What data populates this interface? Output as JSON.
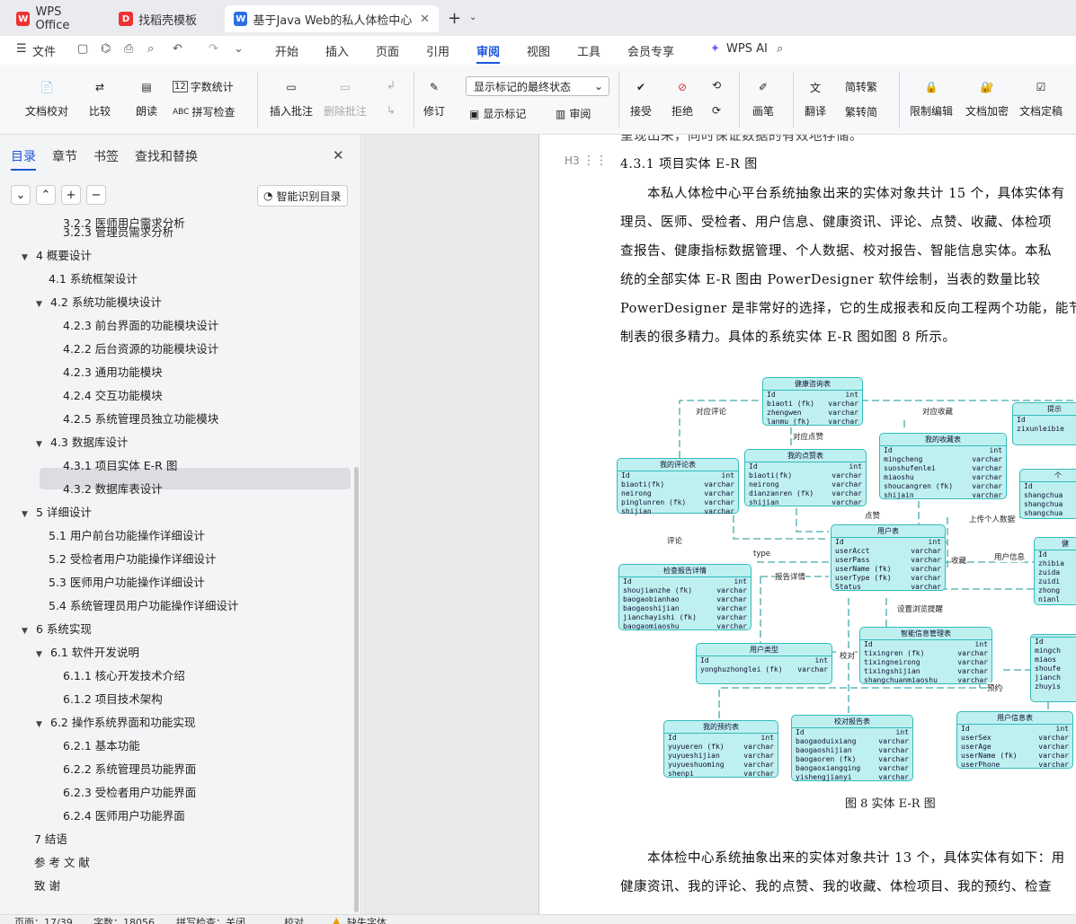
{
  "tabs": [
    {
      "label": "WPS Office",
      "icon": "wps-icon"
    },
    {
      "label": "找稻壳模板",
      "icon": "docer-icon"
    },
    {
      "label": "基于Java Web的私人体检中心",
      "icon": "word-icon"
    }
  ],
  "menu": {
    "file": "文件",
    "items": [
      "开始",
      "插入",
      "页面",
      "引用",
      "审阅",
      "视图",
      "工具",
      "会员专享"
    ],
    "active": "审阅",
    "ai": "WPS AI"
  },
  "ribbon": {
    "doc_check": "文档校对",
    "compare": "比较",
    "read": "朗读",
    "word_count": "字数统计",
    "spell_check": "拼写检查",
    "insert_comment": "插入批注",
    "delete_comment": "删除批注",
    "revise": "修订",
    "markup_state": "显示标记的最终状态",
    "show_markup": "显示标记",
    "review": "审阅",
    "accept": "接受",
    "reject": "拒绝",
    "pen": "画笔",
    "translate": "翻译",
    "to_traditional": "简转繁",
    "to_simplified": "繁转简",
    "restrict_edit": "限制编辑",
    "encrypt": "文档加密",
    "finalize": "文档定稿"
  },
  "panel": {
    "tabs": [
      "目录",
      "章节",
      "书签",
      "查找和替换"
    ],
    "smart_toc": "智能识别目录",
    "toc": [
      {
        "text": "3.2.2  医师用户需求分析",
        "level": 3
      },
      {
        "text": "3.2.3  管理员需求分析",
        "level": 3
      },
      {
        "text": "4  概要设计",
        "level": 1,
        "open": true
      },
      {
        "text": "4.1  系统框架设计",
        "level": 2
      },
      {
        "text": "4.2  系统功能模块设计",
        "level": 2,
        "open": true
      },
      {
        "text": "4.2.3  前台界面的功能模块设计",
        "level": 3
      },
      {
        "text": "4.2.2  后台资源的功能模块设计",
        "level": 3
      },
      {
        "text": "4.2.3  通用功能模块",
        "level": 3
      },
      {
        "text": "4.2.4  交互功能模块",
        "level": 3
      },
      {
        "text": "4.2.5  系统管理员独立功能模块",
        "level": 3
      },
      {
        "text": "4.3  数据库设计",
        "level": 2,
        "open": true
      },
      {
        "text": "4.3.1  项目实体 E-R 图",
        "level": 3,
        "selected": true
      },
      {
        "text": "4.3.2  数据库表设计",
        "level": 3
      },
      {
        "text": "5  详细设计",
        "level": 1,
        "open": true
      },
      {
        "text": "5.1 用户前台功能操作详细设计",
        "level": 2
      },
      {
        "text": "5.2 受检者用户功能操作详细设计",
        "level": 2
      },
      {
        "text": "5.3  医师用户功能操作详细设计",
        "level": 2
      },
      {
        "text": "5.4  系统管理员用户功能操作详细设计",
        "level": 2
      },
      {
        "text": "6  系统实现",
        "level": 1,
        "open": true
      },
      {
        "text": "6.1  软件开发说明",
        "level": 2,
        "open": true
      },
      {
        "text": "6.1.1  核心开发技术介绍",
        "level": 3
      },
      {
        "text": "6.1.2  项目技术架构",
        "level": 3
      },
      {
        "text": "6.2  操作系统界面和功能实现",
        "level": 2,
        "open": true
      },
      {
        "text": "6.2.1  基本功能",
        "level": 3
      },
      {
        "text": "6.2.2  系统管理员功能界面",
        "level": 3
      },
      {
        "text": "6.2.3  受检者用户功能界面",
        "level": 3
      },
      {
        "text": "6.2.4  医师用户功能界面",
        "level": 3
      },
      {
        "text": "7  结语",
        "level": 1
      },
      {
        "text": "参 考 文 献",
        "level": 1
      },
      {
        "text": "致    谢",
        "level": 1
      }
    ]
  },
  "doc": {
    "top_fragment": "呈现出来，同时保证数据的有效地存储。",
    "heading_marker": "H3",
    "heading": "4.3.1  项目实体 E-R 图",
    "para1": [
      "本私人体检中心平台系统抽象出来的实体对象共计 15 个，具体实体有",
      "理员、医师、受检者、用户信息、健康资讯、评论、点赞、收藏、体检项",
      "查报告、健康指标数据管理、个人数据、校对报告、智能信息实体。本私",
      "统的全部实体 E-R 图由 PowerDesigner 软件绘制，当表的数量比较",
      "PowerDesigner 是非常好的选择，它的生成报表和反向工程两个功能，能节",
      "制表的很多精力。具体的系统实体 E-R 图如图 8 所示。"
    ],
    "caption": "图 8  实体 E-R 图",
    "para2": [
      "本体检中心系统抽象出来的实体对象共计 13 个，具体实体有如下：用",
      "健康资讯、我的评论、我的点赞、我的收藏、体检项目、我的预约、检查"
    ]
  },
  "er": {
    "entities": [
      {
        "id": "health",
        "title": "健康咨询表",
        "rows": [
          [
            "Id",
            "int"
          ],
          [
            "biaoti (fk)",
            "varchar"
          ],
          [
            "zhengwen",
            "varchar"
          ],
          [
            "lanmu (fk)",
            "varchar"
          ]
        ]
      },
      {
        "id": "comment",
        "title": "我的评论表",
        "rows": [
          [
            "Id",
            "int"
          ],
          [
            "biaoti(fk)",
            "varchar"
          ],
          [
            "neirong",
            "varchar"
          ],
          [
            "pinglunren (fk)",
            "varchar"
          ],
          [
            "shijian",
            "varchar"
          ]
        ]
      },
      {
        "id": "like",
        "title": "我的点赞表",
        "rows": [
          [
            "Id",
            "int"
          ],
          [
            "biaoti(fk)",
            "varchar"
          ],
          [
            "neirong",
            "varchar"
          ],
          [
            "dianzanren (fk)",
            "varchar"
          ],
          [
            "shijian",
            "varchar"
          ]
        ]
      },
      {
        "id": "fav",
        "title": "我的收藏表",
        "rows": [
          [
            "Id",
            "int"
          ],
          [
            "mingcheng",
            "varchar"
          ],
          [
            "suoshufenlei",
            "varchar"
          ],
          [
            "miaoshu",
            "varchar"
          ],
          [
            "shoucangren (fk)",
            "varchar"
          ],
          [
            "shijain",
            "varchar"
          ]
        ]
      },
      {
        "id": "user",
        "title": "用户表",
        "rows": [
          [
            "Id",
            "int"
          ],
          [
            "userAcct",
            "varchar"
          ],
          [
            "userPass",
            "varchar"
          ],
          [
            "userName (fk)",
            "varchar"
          ],
          [
            "userType (fk)",
            "varchar"
          ],
          [
            "Status",
            "varchar"
          ]
        ]
      },
      {
        "id": "report",
        "title": "检查报告详情",
        "rows": [
          [
            "Id",
            "int"
          ],
          [
            "shoujianzhe (fk)",
            "varchar"
          ],
          [
            "baogaobianhao",
            "varchar"
          ],
          [
            "baogaoshijian",
            "varchar"
          ],
          [
            "jianchayishi (fk)",
            "varchar"
          ],
          [
            "baogaomiaoshu",
            "varchar"
          ]
        ]
      },
      {
        "id": "smart",
        "title": "智能信息管理表",
        "rows": [
          [
            "Id",
            "int"
          ],
          [
            "tixingren (fk)",
            "varchar"
          ],
          [
            "tixingneirong",
            "varchar"
          ],
          [
            "tixingshijian",
            "varchar"
          ],
          [
            "shangchuanmiaoshu",
            "varchar"
          ]
        ]
      },
      {
        "id": "utype",
        "title": "用户类型",
        "rows": [
          [
            "Id",
            "int"
          ],
          [
            "yonghuzhonglei (fk)",
            "varchar"
          ]
        ]
      },
      {
        "id": "appt",
        "title": "我的预约表",
        "rows": [
          [
            "Id",
            "int"
          ],
          [
            "yuyueren (fk)",
            "varchar"
          ],
          [
            "yuyueshijian",
            "varchar"
          ],
          [
            "yuyueshuoming",
            "varchar"
          ],
          [
            "shenpi",
            "varchar"
          ]
        ]
      },
      {
        "id": "check",
        "title": "校对报告表",
        "rows": [
          [
            "Id",
            "int"
          ],
          [
            "baogaoduixiang",
            "varchar"
          ],
          [
            "baogaoshijian",
            "varchar"
          ],
          [
            "baogaoren (fk)",
            "varchar"
          ],
          [
            "baogaoxiangqing",
            "varchar"
          ],
          [
            "yishengjianyi",
            "varchar"
          ]
        ]
      },
      {
        "id": "uinfo",
        "title": "用户信息表",
        "rows": [
          [
            "Id",
            "int"
          ],
          [
            "userSex",
            "varchar"
          ],
          [
            "userAge",
            "varchar"
          ],
          [
            "userName (fk)",
            "varchar"
          ],
          [
            "userPhone",
            "varchar"
          ]
        ]
      },
      {
        "id": "r1",
        "title": "提示",
        "rows": [
          [
            "Id",
            ""
          ],
          [
            "zixunleibie",
            ""
          ]
        ]
      },
      {
        "id": "r2",
        "title": "个",
        "rows": [
          [
            "Id",
            ""
          ],
          [
            "shangchua",
            ""
          ],
          [
            "shangchua",
            ""
          ],
          [
            "shangchua",
            ""
          ]
        ]
      },
      {
        "id": "r3",
        "title": "健",
        "rows": [
          [
            "Id",
            ""
          ],
          [
            "zhibia",
            ""
          ],
          [
            "zuida",
            ""
          ],
          [
            "zuidi",
            ""
          ],
          [
            "zhong",
            ""
          ],
          [
            "nianl",
            ""
          ]
        ]
      },
      {
        "id": "r4",
        "title": "",
        "rows": [
          [
            "Id",
            ""
          ],
          [
            "mingch",
            ""
          ],
          [
            "miaos",
            ""
          ],
          [
            "shoufe",
            ""
          ],
          [
            "jianch",
            ""
          ],
          [
            "zhuyis",
            ""
          ]
        ]
      }
    ],
    "labels": [
      "对应评论",
      "对应收藏",
      "对应点赞",
      "点赞",
      "上传个人数据",
      "评论",
      "type",
      "报告详情",
      "收藏",
      "用户信息",
      "设置浏览提醒",
      "校对",
      "预约"
    ]
  },
  "status": {
    "page": "页面：17/39",
    "words": "字数：18056",
    "spell": "拼写检查：关闭",
    "proof": "校对",
    "font": "缺失字体"
  }
}
